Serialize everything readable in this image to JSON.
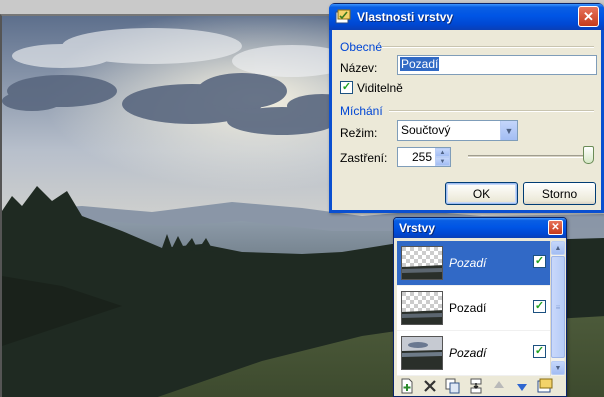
{
  "dialog": {
    "title": "Vlastnosti vrstvy",
    "close_glyph": "✕",
    "section_general": "Obecné",
    "name_label": "Název:",
    "name_value": "Pozadí",
    "visible_label": "Viditelně",
    "visible_checked": true,
    "section_blending": "Míchání",
    "mode_label": "Režim:",
    "mode_value": "Součtový",
    "opacity_label": "Zastření:",
    "opacity_value": "255",
    "opacity_fraction": 1.0,
    "ok_label": "OK",
    "cancel_label": "Storno"
  },
  "layers_panel": {
    "title": "Vrstvy",
    "close_glyph": "✕",
    "layers": [
      {
        "name": "Pozadí",
        "selected": true,
        "visible": true,
        "italic": true,
        "thumb": "checker-over-landscape"
      },
      {
        "name": "Pozadí",
        "selected": false,
        "visible": true,
        "italic": false,
        "thumb": "checker-over-landscape"
      },
      {
        "name": "Pozadí",
        "selected": false,
        "visible": true,
        "italic": true,
        "thumb": "landscape"
      }
    ],
    "toolbar": [
      {
        "name": "add-layer-icon"
      },
      {
        "name": "delete-layer-icon"
      },
      {
        "name": "duplicate-layer-icon"
      },
      {
        "name": "merge-layer-down-icon"
      },
      {
        "name": "move-layer-up-icon"
      },
      {
        "name": "move-layer-down-icon"
      },
      {
        "name": "layer-properties-icon"
      }
    ]
  },
  "colors": {
    "titlebar": "#0054e3",
    "selection": "#316ac5",
    "section_label": "#0046d5",
    "dialog_bg": "#ece9d8"
  }
}
